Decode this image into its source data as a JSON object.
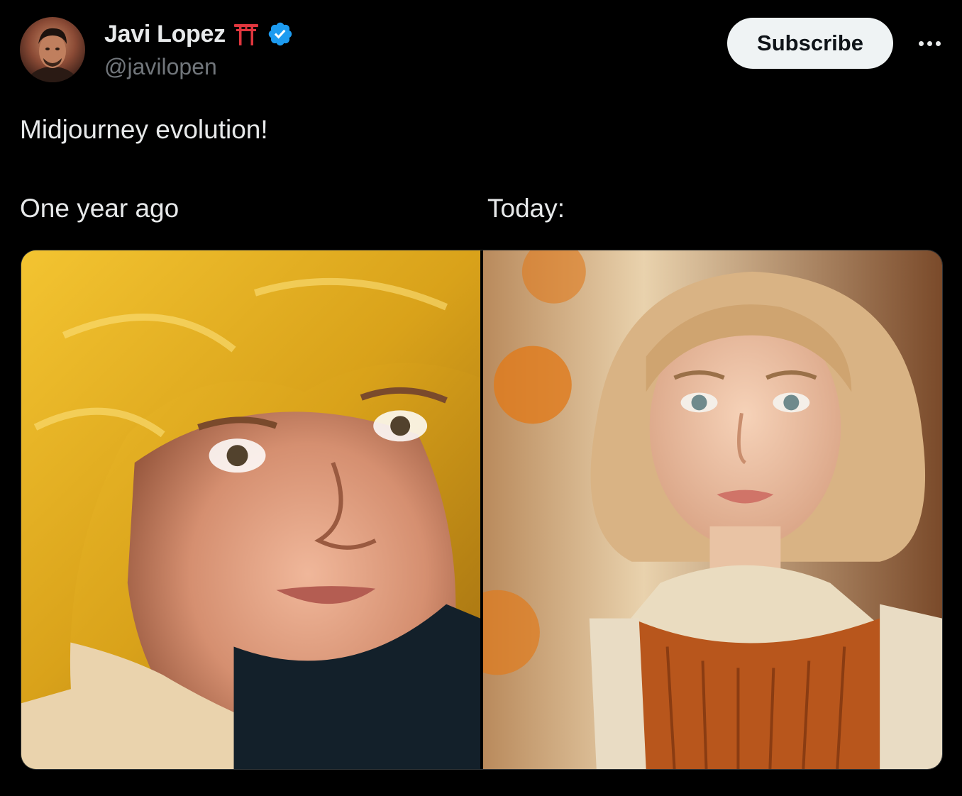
{
  "author": {
    "display_name": "Javi Lopez",
    "handle": "@javilopen",
    "badge_emoji_icon": "torii-gate-icon",
    "verified_icon": "verified-badge-icon",
    "verified_color": "#1d9bf0"
  },
  "actions": {
    "subscribe_label": "Subscribe",
    "more_icon": "more-horizontal-icon"
  },
  "post": {
    "text": "Midjourney evolution!",
    "captions": {
      "left": "One year ago",
      "right": "Today:"
    }
  },
  "media": [
    {
      "caption_ref": "left",
      "subject": "painted portrait, golden curly hair"
    },
    {
      "caption_ref": "right",
      "subject": "photoreal portrait, light curly hair, orange dress"
    }
  ],
  "colors": {
    "background": "#000000",
    "text": "#e7e9ea",
    "secondary_text": "#71767b",
    "button_bg": "#eff3f4",
    "button_text": "#0f1419"
  }
}
